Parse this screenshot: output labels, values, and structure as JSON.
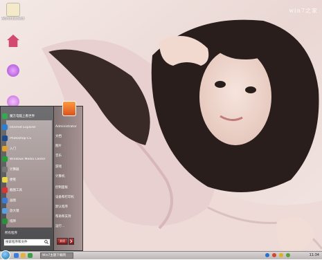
{
  "desktop": {
    "watermark": "win7之家",
    "icons": [
      {
        "label": "Administrator",
        "icon": "folder-icon",
        "color": "#f4e9c8"
      },
      {
        "label": "",
        "icon": "home-icon",
        "color": "#d24b6e"
      },
      {
        "label": "",
        "icon": "network-icon",
        "color": "#a44ad0"
      },
      {
        "label": "",
        "icon": "recycle-bin-icon",
        "color": "#c66ad6"
      }
    ]
  },
  "start_menu": {
    "programs": [
      {
        "label": "魔方电脑上看世界",
        "icon": "globe-icon",
        "color": "#34a853"
      },
      {
        "label": "Internet Explorer",
        "icon": "ie-icon",
        "color": "#2d7fd3"
      },
      {
        "label": "Photoshop CS",
        "icon": "photoshop-icon",
        "color": "#1b4b8a"
      },
      {
        "label": "入门",
        "icon": "getting-started-icon",
        "color": "#e0a030"
      },
      {
        "label": "Windows Media Center",
        "icon": "media-center-icon",
        "color": "#2a9b3a"
      },
      {
        "label": "计算器",
        "icon": "calculator-icon",
        "color": "#777777"
      },
      {
        "label": "便笺",
        "icon": "sticky-notes-icon",
        "color": "#e8d84a"
      },
      {
        "label": "截图工具",
        "icon": "snipping-tool-icon",
        "color": "#d33"
      },
      {
        "label": "画图",
        "icon": "paint-icon",
        "color": "#3a7bd5"
      },
      {
        "label": "放大镜",
        "icon": "magnifier-icon",
        "color": "#5aa0e0"
      },
      {
        "label": "纸牌",
        "icon": "solitaire-icon",
        "color": "#2c8f3c"
      }
    ],
    "all_programs": "所有程序",
    "search_placeholder": "搜索程序和文件",
    "right_links": [
      "Administrator",
      "文档",
      "图片",
      "音乐",
      "游戏",
      "计算机",
      "控制面板",
      "设备和打印机",
      "默认程序",
      "帮助和支持",
      "运行..."
    ],
    "power_label": "关机"
  },
  "taskbar": {
    "window_button": "Win7主题下载网",
    "clock": "11:34"
  }
}
